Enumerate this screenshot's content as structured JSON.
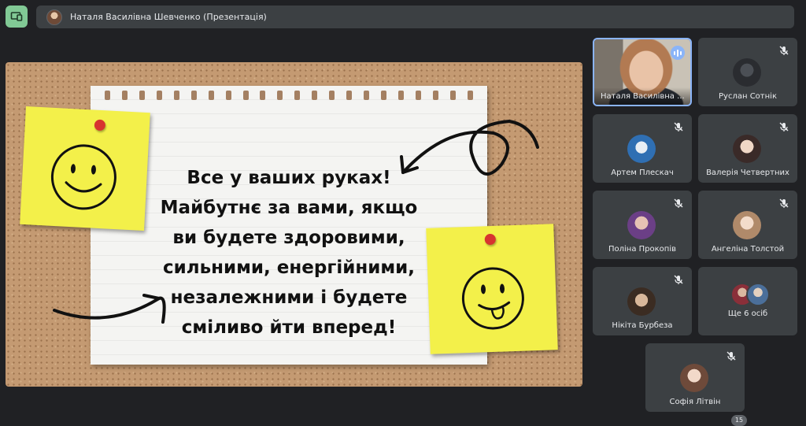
{
  "meeting": {
    "presenter_title": "Наталя Василівна Шевченко (Презентація)"
  },
  "slide": {
    "lines": [
      "Все у ваших руках!",
      "Майбутнє за вами, якщо",
      "ви будете здоровими,",
      "сильними, енергійними,",
      "незалежними і будете",
      "сміливо йти вперед!"
    ]
  },
  "participants": [
    {
      "name": "Наталя Василівна ...",
      "speaking": true
    },
    {
      "name": "Руслан Сотнік",
      "muted": true
    },
    {
      "name": "Артем Плескач",
      "muted": true
    },
    {
      "name": "Валерія Четвертних",
      "muted": true
    },
    {
      "name": "Поліна Прокопів",
      "muted": true
    },
    {
      "name": "Ангеліна Толстой",
      "muted": true
    },
    {
      "name": "Нікіта Бурбеза",
      "muted": true
    },
    {
      "name": "Ще 6 осіб"
    },
    {
      "name": "Софія Літвін",
      "muted": true
    }
  ],
  "participant_count_badge": "15",
  "colors": {
    "background": "#202124",
    "tile": "#3c4043",
    "present_accent": "#81c995",
    "active_speaker": "#8ab4f8"
  },
  "icons": {
    "present": "present-screen-icon",
    "mic_off": "mic-off-icon",
    "speaking": "speaking-indicator-icon"
  }
}
